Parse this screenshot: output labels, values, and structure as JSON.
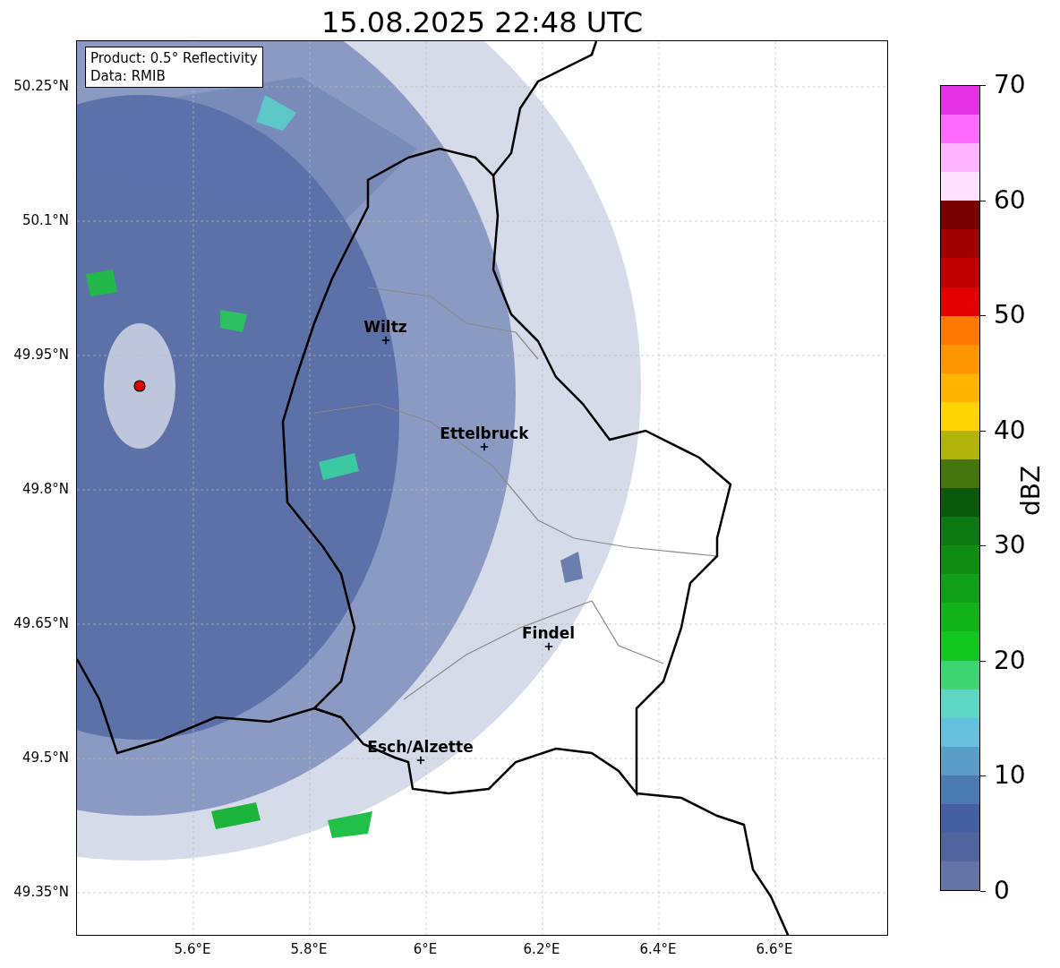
{
  "title": "15.08.2025 22:48 UTC",
  "info_box": [
    "Product: 0.5° Reflectivity",
    "Data: RMIB"
  ],
  "map": {
    "yticks": [
      "50.25°N",
      "50.1°N",
      "49.95°N",
      "49.8°N",
      "49.65°N",
      "49.5°N",
      "49.35°N"
    ],
    "xticks": [
      "5.6°E",
      "5.8°E",
      "6°E",
      "6.2°E",
      "6.4°E",
      "6.6°E"
    ],
    "cities": [
      {
        "name": "Wiltz"
      },
      {
        "name": "Ettelbruck"
      },
      {
        "name": "Findel"
      },
      {
        "name": "Esch/Alzette"
      }
    ]
  },
  "colorbar": {
    "label": "dBZ",
    "ticks": [
      "70",
      "60",
      "50",
      "40",
      "30",
      "20",
      "10",
      "0"
    ],
    "bins": [
      {
        "color": "#e632e6"
      },
      {
        "color": "#ff6aff"
      },
      {
        "color": "#ffb4ff"
      },
      {
        "color": "#ffe0ff"
      },
      {
        "color": "#780000"
      },
      {
        "color": "#a00000"
      },
      {
        "color": "#c00000"
      },
      {
        "color": "#e40000"
      },
      {
        "color": "#ff7800"
      },
      {
        "color": "#ff9600"
      },
      {
        "color": "#ffb400"
      },
      {
        "color": "#ffd400"
      },
      {
        "color": "#b0b40a"
      },
      {
        "color": "#45760e"
      },
      {
        "color": "#085a0a"
      },
      {
        "color": "#0c7a10"
      },
      {
        "color": "#0e8c14"
      },
      {
        "color": "#10a018"
      },
      {
        "color": "#10b41a"
      },
      {
        "color": "#12c81e"
      },
      {
        "color": "#3ed672"
      },
      {
        "color": "#5ed6c4"
      },
      {
        "color": "#64c0dc"
      },
      {
        "color": "#5a9ec8"
      },
      {
        "color": "#4a7ab2"
      },
      {
        "color": "#4460a2"
      },
      {
        "color": "#52649e"
      },
      {
        "color": "#6474a6"
      }
    ]
  }
}
